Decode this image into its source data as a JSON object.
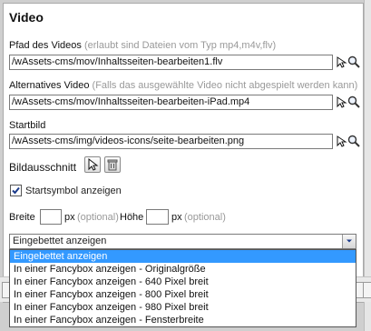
{
  "title": "Video",
  "video_path": {
    "label": "Pfad des Videos",
    "hint": "(erlaubt sind Dateien vom Typ mp4,m4v,flv)",
    "value": "/wAssets-cms/mov/Inhaltsseiten-bearbeiten1.flv"
  },
  "alt_video": {
    "label": "Alternatives Video",
    "hint": "(Falls das ausgewählte Video nicht abgespielt werden kann)",
    "value": "/wAssets-cms/mov/Inhaltsseiten-bearbeiten-iPad.mp4"
  },
  "start_image": {
    "label": "Startbild",
    "value": "/wAssets-cms/img/videos-icons/seite-bearbeiten.png"
  },
  "crop": {
    "label": "Bildausschnitt"
  },
  "start_symbol": {
    "label": "Startsymbol anzeigen",
    "checked": true
  },
  "size": {
    "width_label": "Breite",
    "height_label": "Höhe",
    "unit": "px",
    "optional": "(optional)"
  },
  "display_mode": {
    "selected": "Eingebettet anzeigen",
    "options": [
      "Eingebettet anzeigen",
      "In einer Fancybox anzeigen - Originalgröße",
      "In einer Fancybox anzeigen - 640 Pixel breit",
      "In einer Fancybox anzeigen - 800 Pixel breit",
      "In einer Fancybox anzeigen - 980 Pixel breit",
      "In einer Fancybox anzeigen - Fensterbreite"
    ]
  },
  "colors": {
    "selection": "#3399ff"
  }
}
